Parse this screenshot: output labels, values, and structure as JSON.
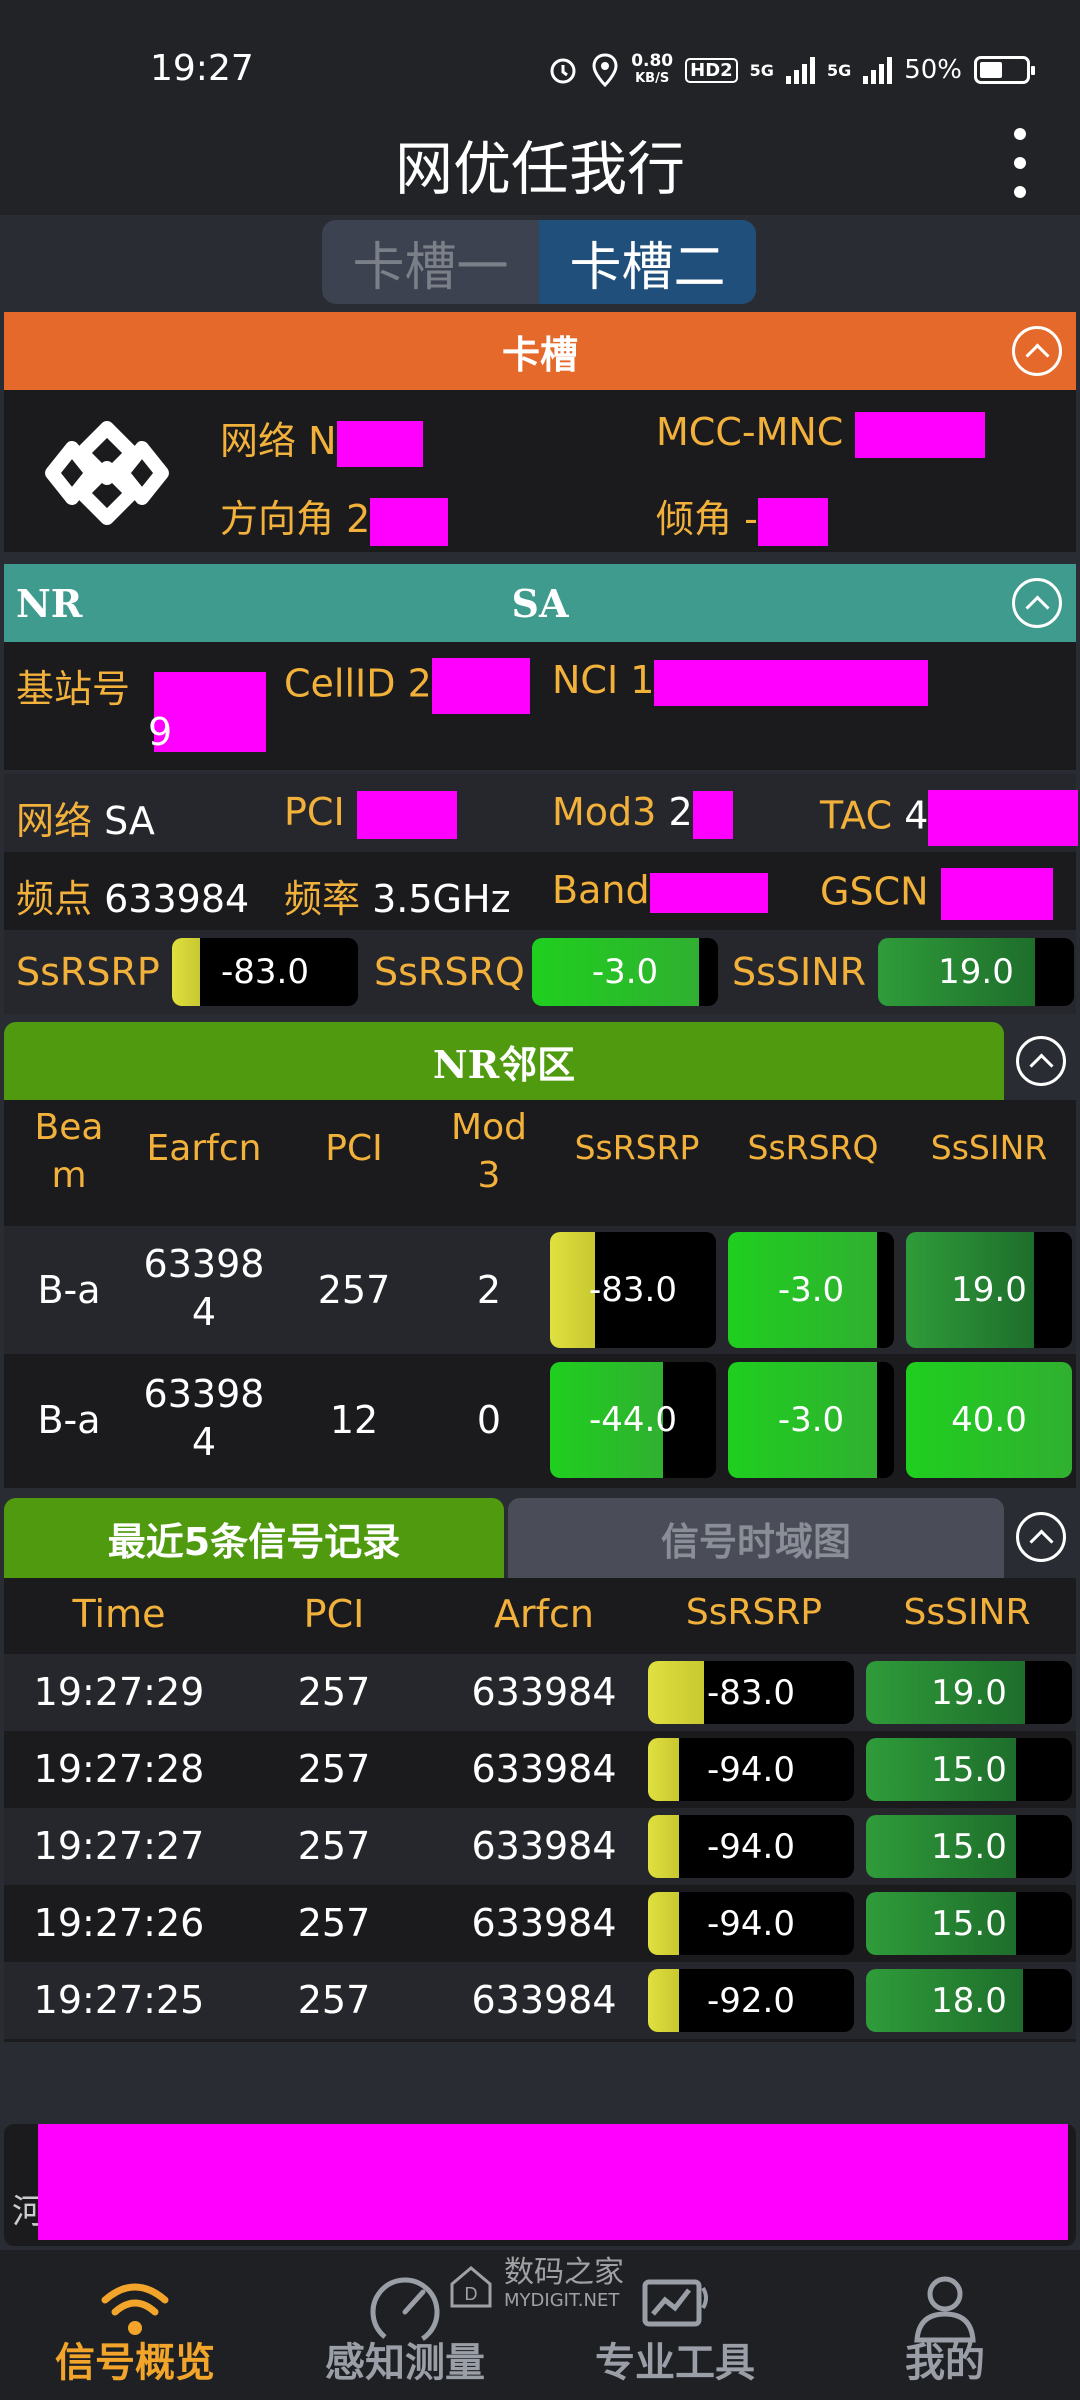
{
  "status": {
    "time": "19:27",
    "speed": "0.80",
    "speed_unit": "KB/S",
    "hd": "HD2",
    "net1": "5G",
    "net2": "5G",
    "battery": "50%"
  },
  "app": {
    "title": "网优任我行"
  },
  "slots": {
    "tab1": "卡槽一",
    "tab2": "卡槽二"
  },
  "card_section": {
    "title": "卡槽",
    "network_label": "网络",
    "network_value": "N",
    "mcc_label": "MCC-MNC",
    "azimuth_label": "方向角",
    "azimuth_value": "2",
    "tilt_label": "倾角",
    "tilt_value": "-"
  },
  "nr_section": {
    "title_left": "NR",
    "title_center": "SA",
    "bs_label": "基站号",
    "bs_value": "9",
    "cellid_label": "CellID",
    "cellid_value": "2",
    "nci_label": "NCI",
    "nci_value": "1",
    "net_label": "网络",
    "net_value": "SA",
    "pci_label": "PCI",
    "mod3_label": "Mod3",
    "mod3_value": "2",
    "tac_label": "TAC",
    "tac_value": "4",
    "freq_point_label": "频点",
    "freq_point_value": "633984",
    "freq_label": "频率",
    "freq_value": "3.5GHz",
    "band_label": "Band",
    "gscn_label": "GSCN",
    "rsrp_label": "SsRSRP",
    "rsrp_value": "-83.0",
    "rsrp_level": 0.15,
    "rsrq_label": "SsRSRQ",
    "rsrq_value": "-3.0",
    "rsrq_level": 0.9,
    "sinr_label": "SsSINR",
    "sinr_value": "19.0",
    "sinr_level": 0.8
  },
  "neighbor_section": {
    "title": "NR邻区",
    "headers": {
      "beam": "Bea\nm",
      "earfcn": "Earfcn",
      "pci": "PCI",
      "mod3": "Mod\n3",
      "rsrp": "SsRSRP",
      "rsrq": "SsRSRQ",
      "sinr": "SsSINR"
    },
    "rows": [
      {
        "beam": "B-a",
        "earfcn": "63398\n4",
        "pci": "257",
        "mod3": "2",
        "rsrp": "-83.0",
        "rsrp_level": 0.27,
        "rsrq": "-3.0",
        "rsrq_level": 0.9,
        "sinr": "19.0",
        "sinr_level": 0.77
      },
      {
        "beam": "B-a",
        "earfcn": "63398\n4",
        "pci": "12",
        "mod3": "0",
        "rsrp": "-44.0",
        "rsrp_level": 0.68,
        "rsrq": "-3.0",
        "rsrq_level": 0.9,
        "sinr": "40.0",
        "sinr_level": 1.0
      }
    ]
  },
  "records_section": {
    "tab_recent": "最近5条信号记录",
    "tab_chart": "信号时域图",
    "headers": {
      "time": "Time",
      "pci": "PCI",
      "arfcn": "Arfcn",
      "rsrp": "SsRSRP",
      "sinr": "SsSINR"
    },
    "rows": [
      {
        "time": "19:27:29",
        "pci": "257",
        "arfcn": "633984",
        "rsrp": "-83.0",
        "rsrp_level": 0.27,
        "sinr": "19.0",
        "sinr_level": 0.77
      },
      {
        "time": "19:27:28",
        "pci": "257",
        "arfcn": "633984",
        "rsrp": "-94.0",
        "rsrp_level": 0.15,
        "sinr": "15.0",
        "sinr_level": 0.73
      },
      {
        "time": "19:27:27",
        "pci": "257",
        "arfcn": "633984",
        "rsrp": "-94.0",
        "rsrp_level": 0.15,
        "sinr": "15.0",
        "sinr_level": 0.73
      },
      {
        "time": "19:27:26",
        "pci": "257",
        "arfcn": "633984",
        "rsrp": "-94.0",
        "rsrp_level": 0.15,
        "sinr": "15.0",
        "sinr_level": 0.73
      },
      {
        "time": "19:27:25",
        "pci": "257",
        "arfcn": "633984",
        "rsrp": "-92.0",
        "rsrp_level": 0.15,
        "sinr": "18.0",
        "sinr_level": 0.76
      }
    ]
  },
  "location_bar": {
    "prefix": "河"
  },
  "watermark": {
    "text": "数码之家",
    "sub": "MYDIGIT.NET"
  },
  "nav": {
    "item1": "信号概览",
    "item2": "感知测量",
    "item3": "专业工具",
    "item4": "我的"
  },
  "colors": {
    "orange": "#e4692a",
    "teal": "#3e9b8d",
    "green": "#4f9a0f",
    "label": "#f2b13b"
  }
}
